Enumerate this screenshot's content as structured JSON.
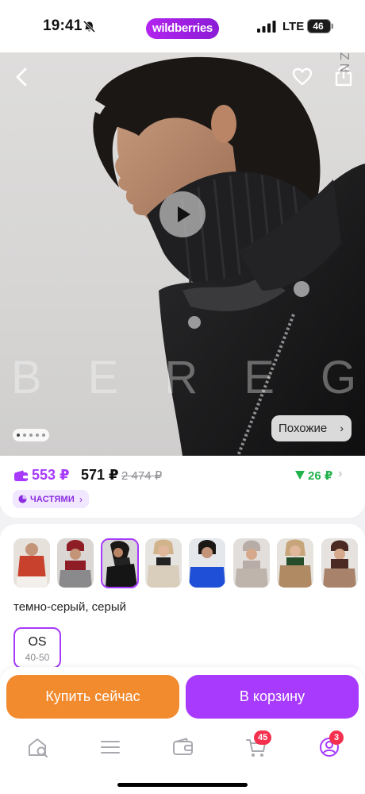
{
  "status_bar": {
    "time": "19:41",
    "carrier_brand": "wildberries",
    "network": "LTE",
    "battery": "46"
  },
  "hero": {
    "watermark": "BEREG",
    "similar_label": "Похожие",
    "side_letters": "ZN"
  },
  "price": {
    "wallet_price": "553 ₽",
    "regular_price": "571 ₽",
    "old_price": "2 474 ₽",
    "discount": "26 ₽",
    "installments": "ЧАСТЯМИ"
  },
  "variants": {
    "color_name": "темно-серый, серый",
    "size": {
      "label": "OS",
      "range": "40-50"
    }
  },
  "actions": {
    "buy_now": "Купить сейчас",
    "to_cart": "В корзину"
  },
  "tabbar": {
    "cart_badge": "45",
    "profile_badge": "3"
  },
  "colors": {
    "brand": "#a73afd",
    "buy_now": "#f28a2e",
    "discount_green": "#22b24c",
    "badge_red": "#f5304e"
  }
}
